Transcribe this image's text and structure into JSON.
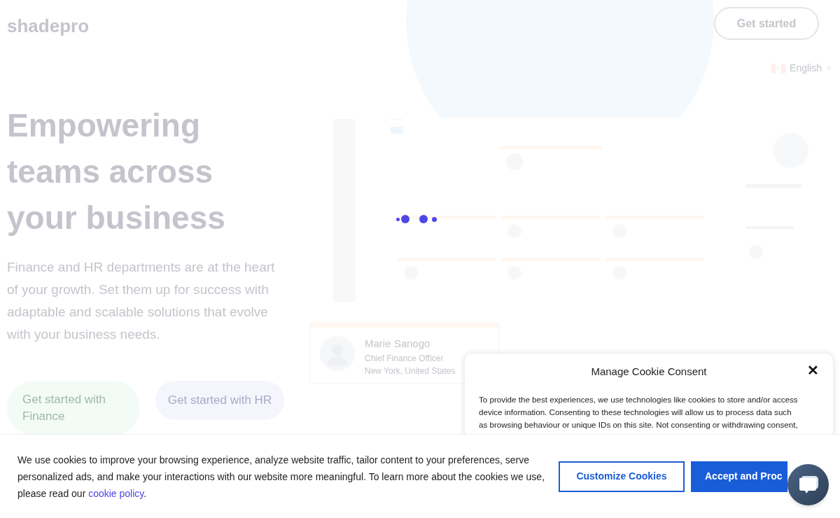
{
  "header": {
    "logo": "shadepro",
    "cta": "Get started",
    "language": {
      "label": "English"
    }
  },
  "hero": {
    "heading": "Empowering teams across your business",
    "text": "Finance and HR departments are at the heart of your growth. Set them up for success with adaptable and scalable solutions that evolve with your business needs.",
    "buttons": [
      {
        "label": "Get started with Finance",
        "kind": "finance"
      },
      {
        "label": "Get started with HR",
        "kind": "hr"
      }
    ]
  },
  "preview": {
    "profile_card": {
      "name": "Marie Sanogo",
      "title": "Chief Finance Officer",
      "location": "New York, United States"
    }
  },
  "cookie_modal": {
    "title": "Manage Cookie Consent",
    "close": "✕",
    "text": "To provide the best experiences, we use technologies like cookies to store and/or access device information. Consenting to these technologies will allow us to process data such as browsing behaviour or unique IDs on this site. Not consenting or withdrawing consent,"
  },
  "cookie_banner": {
    "text_before": "We use cookies to improve your browsing experience, analyze website traffic, tailor content to your preferences, serve personalized ads, and make your interactions with our website more meaningful. To learn more about the cookies we use, please read our ",
    "link": "cookie policy",
    "text_after": ".",
    "buttons": [
      {
        "label": "Customize Cookies",
        "kind": "outline"
      },
      {
        "label": "Accept and Proc",
        "kind": "primary"
      }
    ]
  }
}
